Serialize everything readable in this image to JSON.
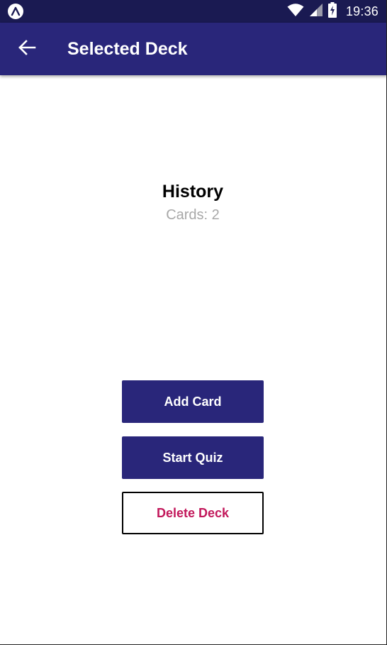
{
  "status_bar": {
    "time": "19:36",
    "app_icon": "expo-icon",
    "wifi_icon": "wifi-icon",
    "signal_icon": "signal-icon",
    "battery_icon": "battery-charging-icon"
  },
  "app_bar": {
    "back_icon": "arrow-back-icon",
    "title": "Selected Deck"
  },
  "deck": {
    "title": "History",
    "count_label": "Cards: 2"
  },
  "actions": {
    "add_card_label": "Add Card",
    "start_quiz_label": "Start Quiz",
    "delete_deck_label": "Delete Deck"
  },
  "colors": {
    "status_bar": "#1a1a52",
    "primary": "#29267a",
    "delete_text": "#c2185b",
    "subtitle": "#a8a8a8"
  }
}
